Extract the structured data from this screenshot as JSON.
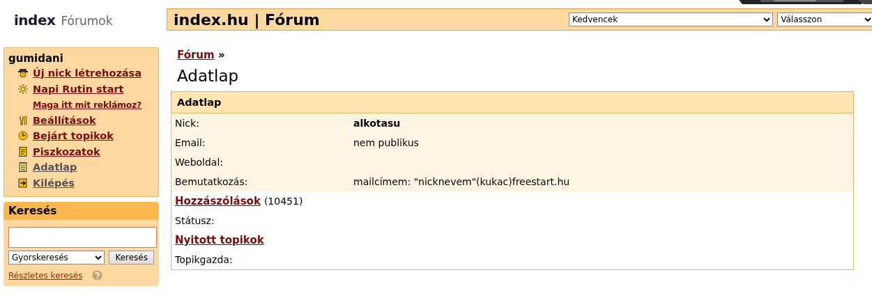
{
  "header": {
    "logo": "index",
    "logo_subtitle": "Fórumok",
    "title": "index.hu | Fórum",
    "favorites_select": "Kedvencek",
    "choose_select": "Válasszon"
  },
  "user_panel": {
    "username": "gumidani",
    "items": [
      {
        "label": "Új nick létrehozása",
        "kind": "newnick",
        "visited": false
      },
      {
        "label": "Napi Rutin start",
        "kind": "routine",
        "visited": false
      },
      {
        "label": "Maga itt mit reklámoz?",
        "kind": "ad",
        "visited": false
      },
      {
        "label": "Beállítások",
        "kind": "settings",
        "visited": false
      },
      {
        "label": "Bejárt topikok",
        "kind": "history",
        "visited": false
      },
      {
        "label": "Piszkozatok",
        "kind": "drafts",
        "visited": false
      },
      {
        "label": "Adatlap",
        "kind": "profile",
        "visited": true
      },
      {
        "label": "Kilépés",
        "kind": "logout",
        "visited": true
      }
    ]
  },
  "search_panel": {
    "title": "Keresés",
    "mode_select": "Gyorskeresés",
    "search_button": "Keresés",
    "advanced_link": "Részletes keresés"
  },
  "breadcrumb": {
    "link": "Fórum",
    "separator": "»"
  },
  "page_title": "Adatlap",
  "profile": {
    "title": "Adatlap",
    "details": [
      {
        "label": "Nick:",
        "value": "alkotasu",
        "bold": true
      },
      {
        "label": "Email:",
        "value": "nem publikus",
        "bold": false
      },
      {
        "label": "Weboldal:",
        "bold": false
      },
      {
        "label": "Bemutatkozás:",
        "value": "mailcímem: \"nicknevem\"(kukac)freestart.hu",
        "bold": false
      }
    ],
    "stats": [
      {
        "kind": "link",
        "label": "Hozzászólások",
        "count": "(10451)"
      },
      {
        "kind": "text",
        "label": "Státusz:"
      },
      {
        "kind": "link",
        "label": "Nyitott topikok"
      },
      {
        "kind": "text",
        "label": "Topikgazda:"
      }
    ]
  }
}
